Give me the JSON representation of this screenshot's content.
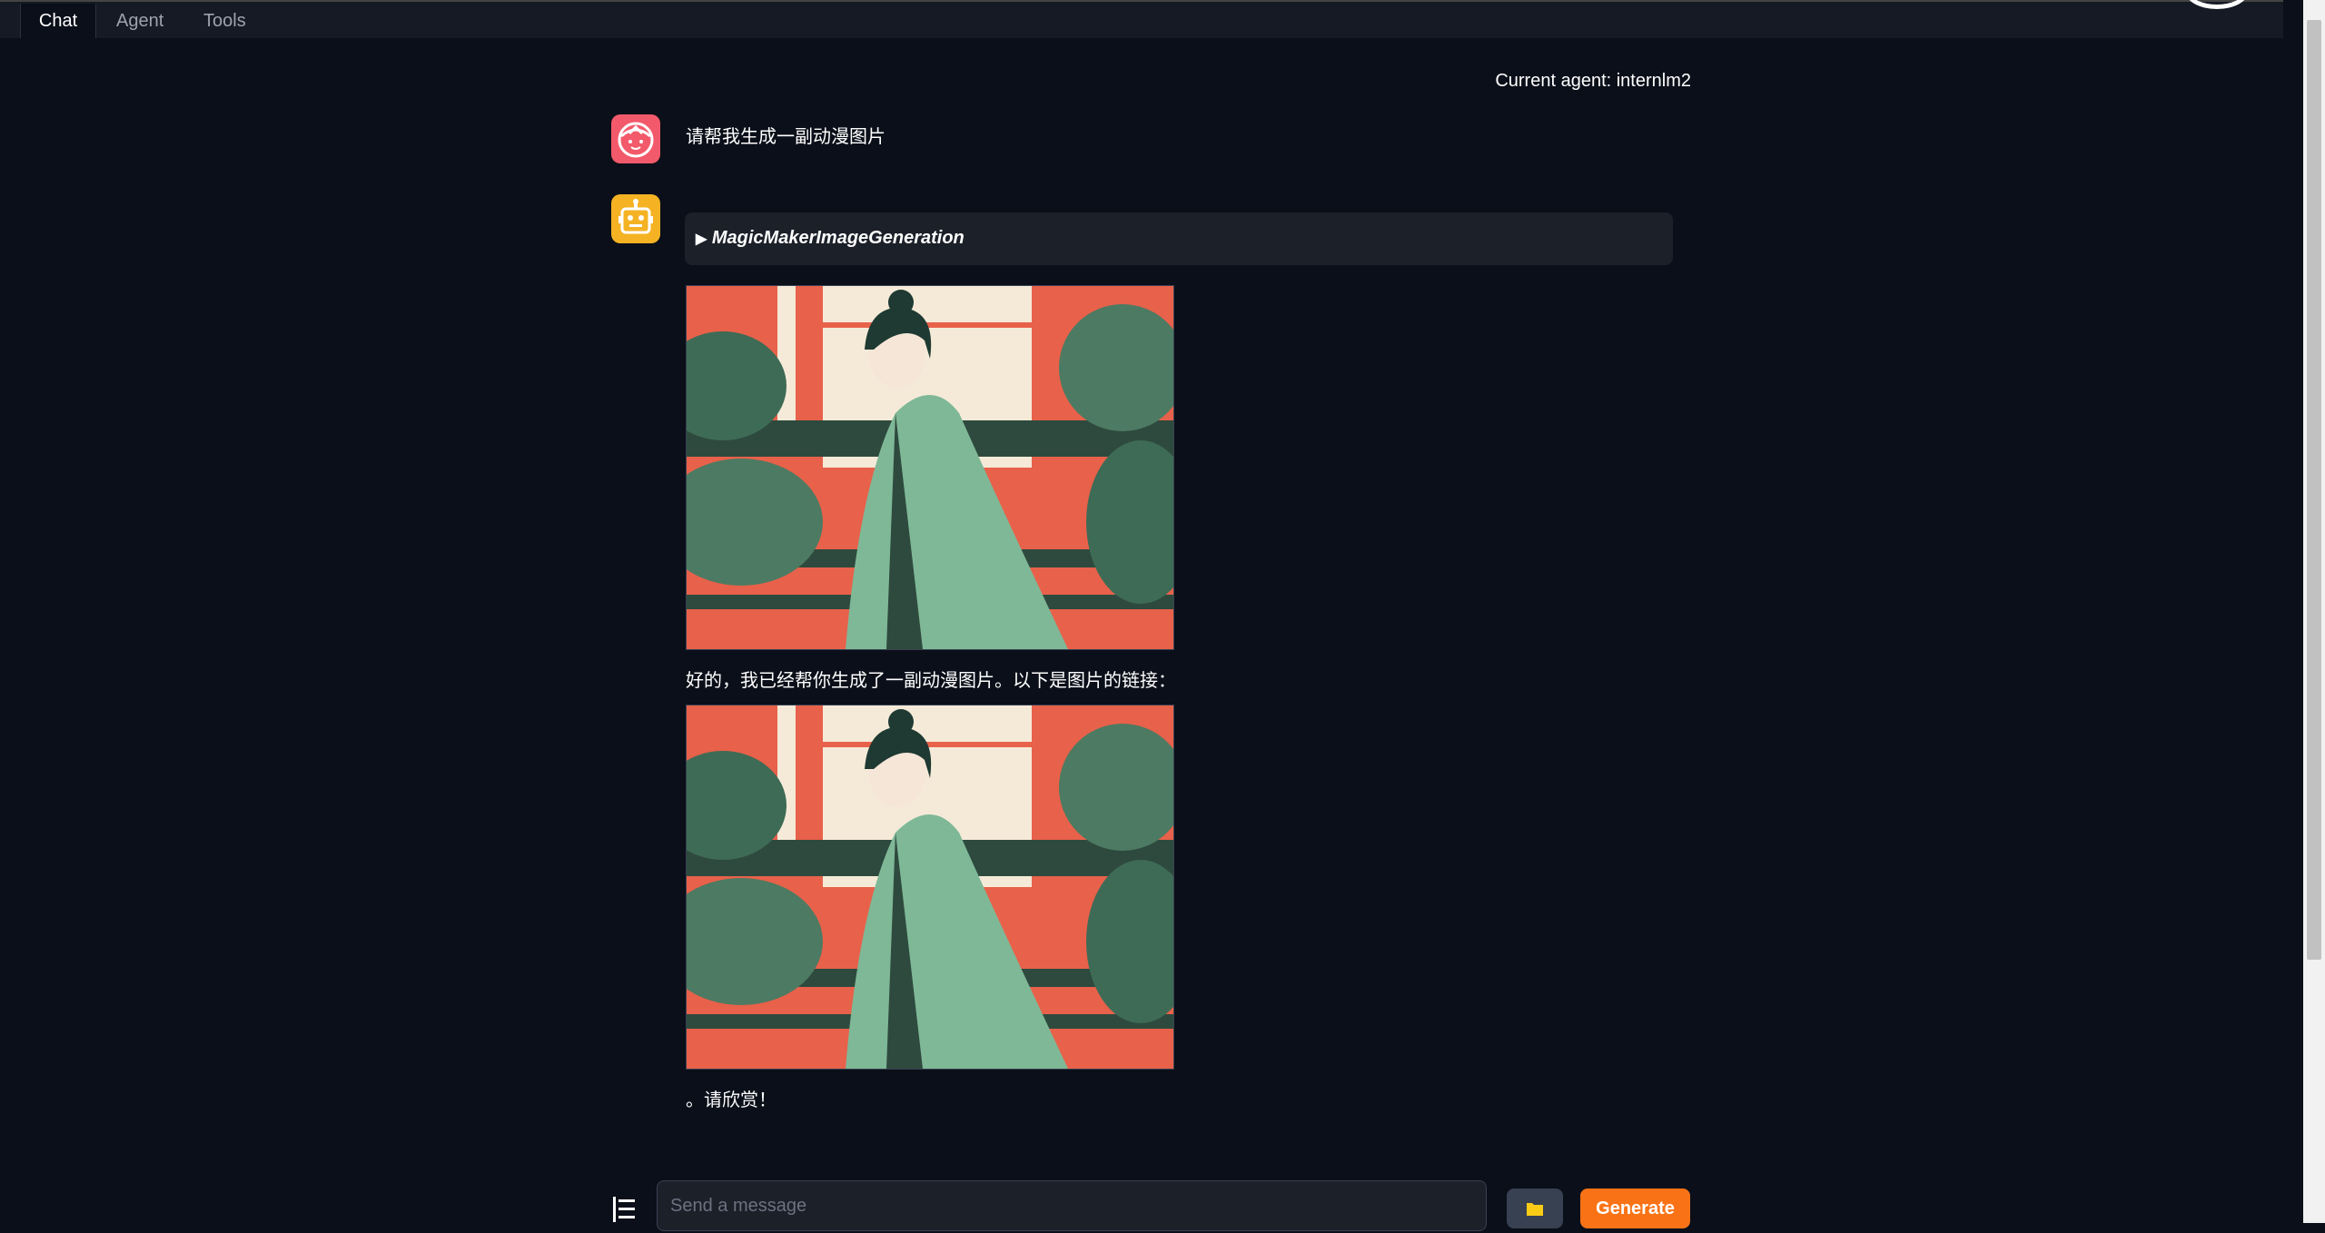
{
  "tabs": [
    {
      "label": "Chat",
      "active": true
    },
    {
      "label": "Agent",
      "active": false
    },
    {
      "label": "Tools",
      "active": false
    }
  ],
  "current_agent": "Current agent: internlm2",
  "messages": {
    "user": {
      "text": "请帮我生成一副动漫图片"
    },
    "bot": {
      "tool_name": "MagicMakerImageGeneration",
      "reply_text": "好的，我已经帮你生成了一副动漫图片。以下是图片的链接：",
      "closing_text": "。请欣赏！"
    }
  },
  "composer": {
    "placeholder": "Send a message",
    "generate_label": "Generate"
  },
  "colors": {
    "background": "#0b0f19",
    "generate_button": "#f97316",
    "user_avatar": "#f25a6b",
    "bot_avatar": "#f5b324"
  },
  "icons": [
    "user-avatar-icon",
    "robot-avatar-icon",
    "triangle-expand-icon",
    "folder-icon",
    "menu-icon"
  ]
}
